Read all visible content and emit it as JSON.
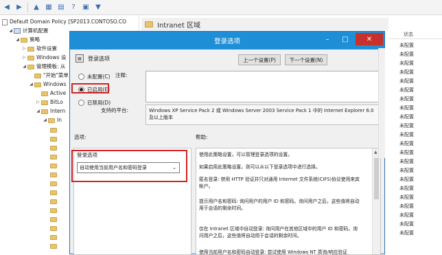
{
  "tree": {
    "root_label": "Default Domain Policy [SP2013.CONTOSO.CO",
    "items": [
      {
        "label": "计算机配置"
      },
      {
        "label": "策略"
      },
      {
        "label": "软件设置"
      },
      {
        "label": "Windows 设"
      },
      {
        "label": "管理模板: 从"
      },
      {
        "label": "\"开始\"菜单"
      },
      {
        "label": "Windows"
      },
      {
        "label": "Active"
      },
      {
        "label": "BitLo"
      },
      {
        "label": "Intern"
      },
      {
        "label": "In"
      }
    ]
  },
  "zone_header": "Intranet 区域",
  "status_column": {
    "header": "状态",
    "items": [
      "未配置",
      "未配置",
      "未配置",
      "未配置",
      "未配置",
      "未配置",
      "未配置",
      "未配置",
      "未配置",
      "未配置",
      "未配置",
      "未配置",
      "未配置",
      "未配置",
      "未配置",
      "未配置",
      "未配置",
      "未配置",
      "未配置",
      "未配置",
      "未配置",
      "未配置"
    ]
  },
  "dialog": {
    "title": "登录选项",
    "setting_name": "登录选项",
    "prev_button": "上一个设置(P)",
    "next_button": "下一个设置(N)",
    "radio_not_configured": "未配置(C)",
    "radio_enabled": "已启用(E)",
    "radio_disabled": "已禁用(D)",
    "selected_state": "enabled",
    "comment_label": "注释:",
    "supported_label": "支持的平台:",
    "supported_text": "Windows XP Service Pack 2 或 Windows Server 2003 Service Pack 1 中的 Internet Explorer 6.0 及以上版本",
    "options_label": "选项:",
    "help_label": "帮助:",
    "options": {
      "heading": "登录选项",
      "selected": "自动使用当前用户名和密码登录"
    },
    "help_paragraphs": [
      "使用此策略设置，可以管理登录选项的设置。",
      "如果启用此策略设置，则可以从以下登录选项中进行选择。",
      "匿名登录: 禁用 HTTP 验证并只对通用 Internet 文件系统(CIFS)协议使用来宾帐户。",
      "提示用户名和密码: 询问用户的用户 ID 和密码。询问用户之后，这些值将自动用于会话的剩余时间。",
      "仅在 Intranet 区域中自动登录: 询问用户在其他区域中的用户 ID 和密码。询问用户之后，这些值将自动用于会话的剩余时间。",
      "使用当前用户名和密码自动登录: 尝试使用 Windows NT 质询/响应验证"
    ]
  }
}
